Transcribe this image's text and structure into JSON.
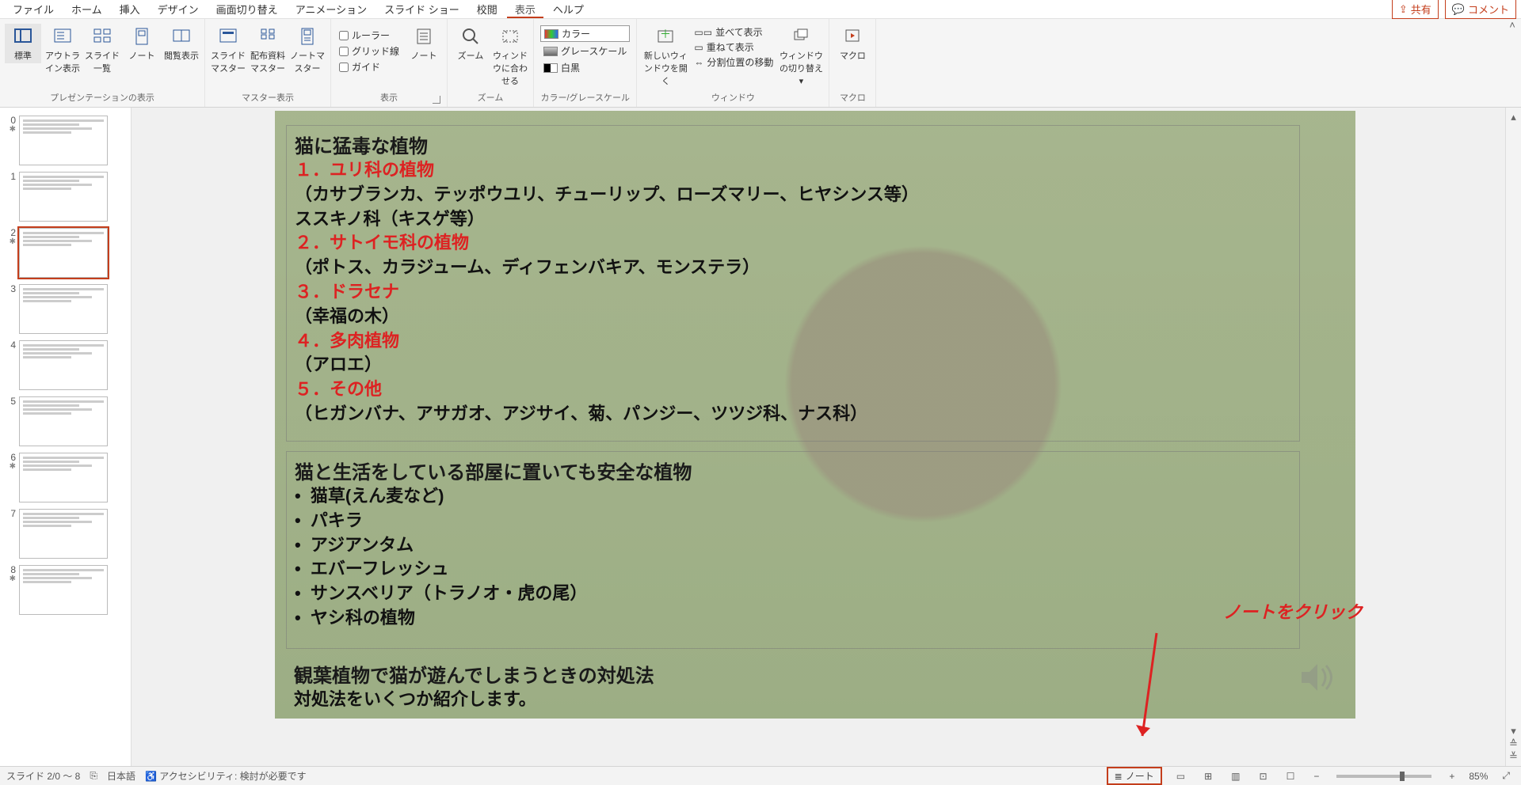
{
  "menu": {
    "items": [
      "ファイル",
      "ホーム",
      "挿入",
      "デザイン",
      "画面切り替え",
      "アニメーション",
      "スライド ショー",
      "校閲",
      "表示",
      "ヘルプ"
    ],
    "active_index": 8,
    "share": "共有",
    "comment": "コメント"
  },
  "ribbon": {
    "groups": {
      "presentation_views": {
        "label": "プレゼンテーションの表示",
        "normal": "標準",
        "outline": "アウトライン表示",
        "sorter": "スライド一覧",
        "notes": "ノート",
        "reading": "閲覧表示"
      },
      "master_views": {
        "label": "マスター表示",
        "slide_master": "スライドマスター",
        "handout_master": "配布資料マスター",
        "notes_master": "ノートマスター"
      },
      "show": {
        "label": "表示",
        "ruler": "ルーラー",
        "gridlines": "グリッド線",
        "guides": "ガイド"
      },
      "notes_btn": {
        "label": "ノート"
      },
      "zoom": {
        "label": "ズーム",
        "zoom": "ズーム",
        "fit": "ウィンドウに合わせる"
      },
      "color": {
        "label": "カラー/グレースケール",
        "color": "カラー",
        "grayscale": "グレースケール",
        "bw": "白黒"
      },
      "window": {
        "label": "ウィンドウ",
        "new": "新しいウィンドウを開く",
        "arrange": "並べて表示",
        "cascade": "重ねて表示",
        "split": "分割位置の移動",
        "switch": "ウィンドウの切り替え"
      },
      "macros": {
        "label": "マクロ",
        "btn": "マクロ"
      }
    }
  },
  "thumbnails": {
    "items": [
      {
        "num": "0",
        "star": true
      },
      {
        "num": "1"
      },
      {
        "num": "2",
        "star": true,
        "selected": true
      },
      {
        "num": "3"
      },
      {
        "num": "4"
      },
      {
        "num": "5"
      },
      {
        "num": "6",
        "star": true
      },
      {
        "num": "7"
      },
      {
        "num": "8",
        "star": true
      }
    ]
  },
  "slide": {
    "box1": {
      "title": "猫に猛毒な植物",
      "l1": "１．ユリ科の植物",
      "l1b": "（カサブランカ、テッポウユリ、チューリップ、ローズマリー、ヒヤシンス等）",
      "l1c": "ススキノ科（キスゲ等）",
      "l2": "２．サトイモ科の植物",
      "l2b": "（ポトス、カラジューム、ディフェンバキア、モンステラ）",
      "l3": "３．ドラセナ",
      "l3b": "（幸福の木）",
      "l4": "４．多肉植物",
      "l4b": "（アロエ）",
      "l5": "５．その他",
      "l5b": "（ヒガンバナ、アサガオ、アジサイ、菊、パンジー、ツツジ科、ナス科）"
    },
    "box2": {
      "title": "猫と生活をしている部屋に置いても安全な植物",
      "items": [
        "猫草(えん麦など)",
        "パキラ",
        "アジアンタム",
        "エバーフレッシュ",
        "サンスベリア（トラノオ・虎の尾）",
        "ヤシ科の植物"
      ]
    },
    "box3": {
      "title": "観葉植物で猫が遊んでしまうときの対処法",
      "sub": "対処法をいくつか紹介します。"
    },
    "annotation": "ノートをクリック"
  },
  "status": {
    "slide_info": "スライド 2/0 ～ 8",
    "lang": "日本語",
    "accessibility": "アクセシビリティ: 検討が必要です",
    "notes": "ノート",
    "zoom_pct": "85%"
  }
}
